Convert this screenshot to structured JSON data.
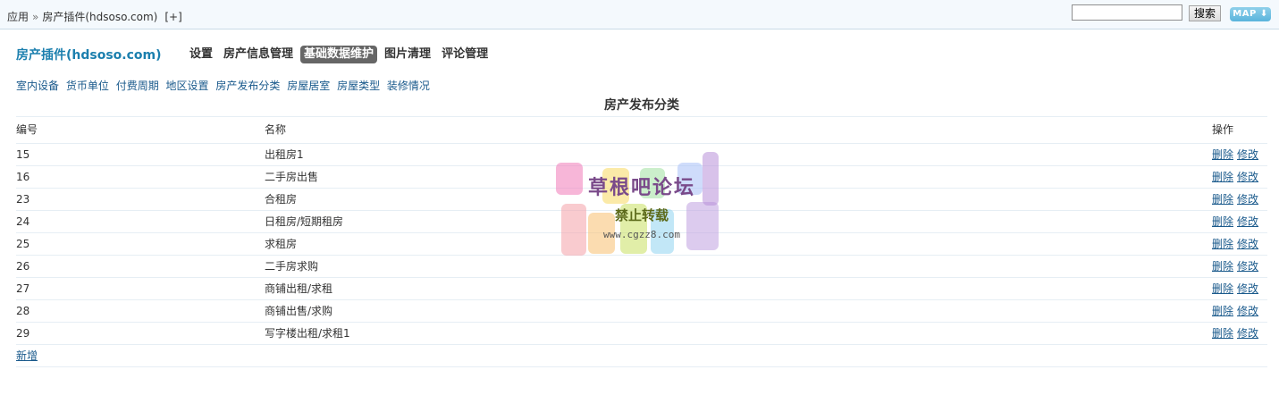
{
  "topbar": {
    "breadcrumb": [
      "应用",
      "房产插件(hdsoso.com)"
    ],
    "breadcrumb_sep": "»",
    "add_shortcut": "[+]",
    "search_placeholder": "",
    "search_button": "搜索",
    "map_button": "MAP",
    "map_icon": "arrow-down-icon"
  },
  "plugin": {
    "title": "房产插件(hdsoso.com)",
    "nav": [
      {
        "label": "设置",
        "active": false
      },
      {
        "label": "房产信息管理",
        "active": false
      },
      {
        "label": "基础数据维护",
        "active": true
      },
      {
        "label": "图片清理",
        "active": false
      },
      {
        "label": "评论管理",
        "active": false
      }
    ]
  },
  "subnav": [
    "室内设备",
    "货币单位",
    "付费周期",
    "地区设置",
    "房产发布分类",
    "房屋居室",
    "房屋类型",
    "装修情况"
  ],
  "section": {
    "title": "房产发布分类"
  },
  "table": {
    "headers": {
      "id": "编号",
      "name": "名称",
      "ops": "操作"
    },
    "rows": [
      {
        "id": "15",
        "name": "出租房1"
      },
      {
        "id": "16",
        "name": "二手房出售"
      },
      {
        "id": "23",
        "name": "合租房"
      },
      {
        "id": "24",
        "name": "日租房/短期租房"
      },
      {
        "id": "25",
        "name": "求租房"
      },
      {
        "id": "26",
        "name": "二手房求购"
      },
      {
        "id": "27",
        "name": "商铺出租/求租"
      },
      {
        "id": "28",
        "name": "商铺出售/求购"
      },
      {
        "id": "29",
        "name": "写字楼出租/求租1"
      }
    ],
    "delete_label": "删除",
    "edit_label": "修改",
    "add_label": "新增"
  },
  "watermark": {
    "line1": "草根吧论坛",
    "line2": "禁止转载",
    "line3": "www.cgzz8.com"
  },
  "colors": {
    "accent": "#1b7fae",
    "link": "#1a5a8c",
    "active_tab_bg": "#666666",
    "topbar_bg": "#f4f9fd"
  }
}
